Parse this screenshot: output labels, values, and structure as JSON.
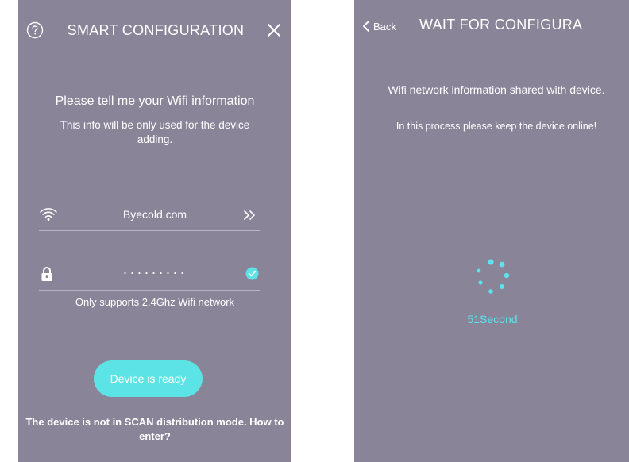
{
  "colors": {
    "screen_background": "#8a8499",
    "accent": "#5ce3e6",
    "countdown_text": "#5de2ee"
  },
  "smart_config": {
    "title": "SMART CONFIGURATION",
    "icons": {
      "help": "help-circle-icon",
      "close": "close-icon",
      "wifi": "wifi-icon",
      "next": "chevron-double-right-icon",
      "lock": "lock-icon",
      "check": "check-circle-icon"
    },
    "prompt": "Please tell me your Wifi information",
    "subprompt": "This info will be only used for the device adding.",
    "ssid": "Byecold.com",
    "password_masked": "·········",
    "support_note": "Only supports 2.4Ghz Wifi network",
    "ready_button_label": "Device is ready",
    "scan_help": "The device is not in SCAN distribution mode. How to enter?"
  },
  "wait_config": {
    "back_label": "Back",
    "title": "WAIT FOR CONFIGURA",
    "icons": {
      "back": "chevron-left-icon",
      "spinner": "loading-spinner-icon"
    },
    "shared_message": "Wifi network information shared with device.",
    "keep_online_message": "In this process please keep the device online!",
    "countdown": "51Second"
  }
}
